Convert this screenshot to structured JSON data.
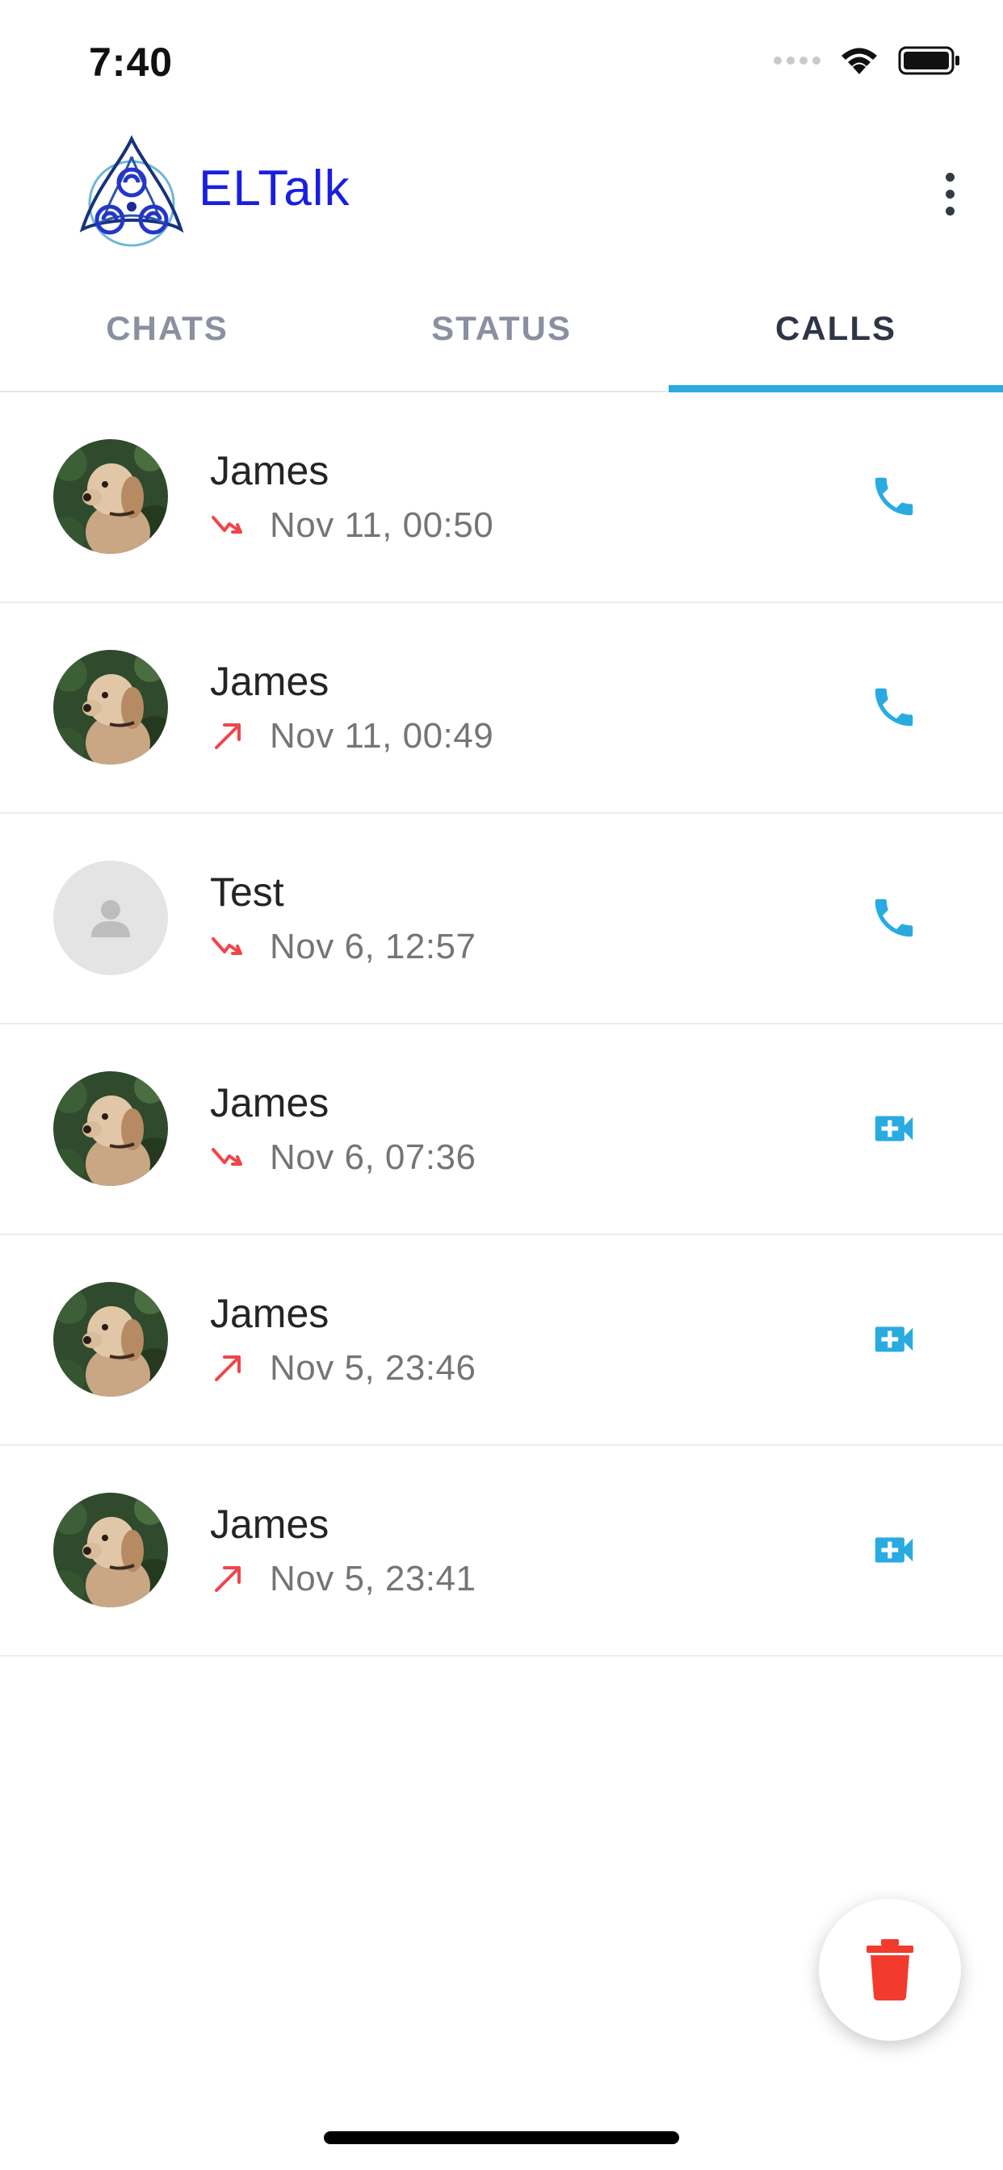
{
  "status_bar": {
    "time": "7:40"
  },
  "header": {
    "title": "ELTalk"
  },
  "tabs": [
    {
      "label": "CHATS",
      "active": false
    },
    {
      "label": "STATUS",
      "active": false
    },
    {
      "label": "CALLS",
      "active": true
    }
  ],
  "calls": [
    {
      "name": "James",
      "time": "Nov 11, 00:50",
      "direction": "missed",
      "type": "voice",
      "avatar": "dog-photo"
    },
    {
      "name": "James",
      "time": "Nov 11, 00:49",
      "direction": "outgoing",
      "type": "voice",
      "avatar": "dog-photo"
    },
    {
      "name": "Test",
      "time": "Nov 6, 12:57",
      "direction": "missed",
      "type": "voice",
      "avatar": "default-person"
    },
    {
      "name": "James",
      "time": "Nov 6, 07:36",
      "direction": "missed",
      "type": "video",
      "avatar": "dog-photo"
    },
    {
      "name": "James",
      "time": "Nov 5, 23:46",
      "direction": "outgoing",
      "type": "video",
      "avatar": "dog-photo"
    },
    {
      "name": "James",
      "time": "Nov 5, 23:41",
      "direction": "outgoing",
      "type": "video",
      "avatar": "dog-photo"
    }
  ],
  "colors": {
    "accent": "#29abe2",
    "title": "#1a1ee0",
    "missed_arrow": "#f0454a",
    "delete": "#f23b2d"
  },
  "icons": {
    "menu": "more-vertical-icon",
    "voice_call": "phone-icon",
    "video_call": "video-call-icon",
    "fab": "trash-icon"
  }
}
